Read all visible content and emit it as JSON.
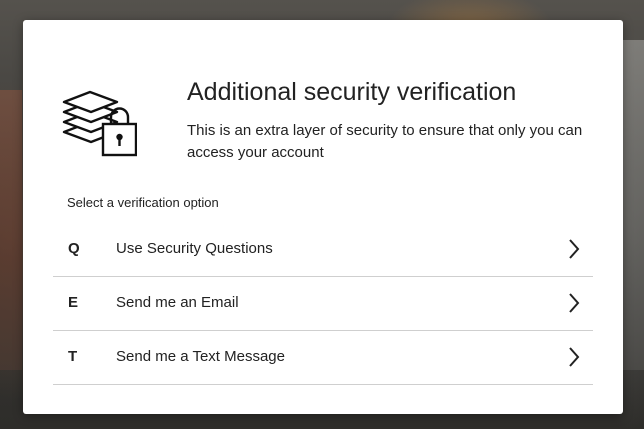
{
  "dialog": {
    "title": "Additional security verification",
    "subtitle": "This is an extra layer of security to ensure that only you can access your account",
    "logo_icon": "stacked-layers-padlock-icon"
  },
  "verification": {
    "prompt": "Select a verification option",
    "options": [
      {
        "key": "Q",
        "label": "Use Security Questions",
        "icon": "chevron-right-icon"
      },
      {
        "key": "E",
        "label": "Send me an Email",
        "icon": "chevron-right-icon"
      },
      {
        "key": "T",
        "label": "Send me a Text Message",
        "icon": "chevron-right-icon"
      }
    ]
  },
  "colors": {
    "text": "#222222",
    "card_background": "#ffffff",
    "divider": "#cfcfcf"
  }
}
